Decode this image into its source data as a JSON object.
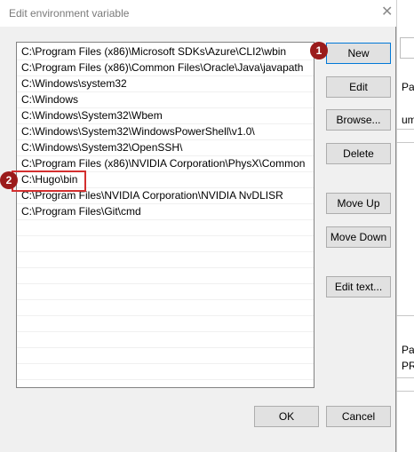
{
  "dialog": {
    "title": "Edit environment variable",
    "close_glyph": "✕"
  },
  "paths": [
    "C:\\Program Files (x86)\\Microsoft SDKs\\Azure\\CLI2\\wbin",
    "C:\\Program Files (x86)\\Common Files\\Oracle\\Java\\javapath",
    "C:\\Windows\\system32",
    "C:\\Windows",
    "C:\\Windows\\System32\\Wbem",
    "C:\\Windows\\System32\\WindowsPowerShell\\v1.0\\",
    "C:\\Windows\\System32\\OpenSSH\\",
    "C:\\Program Files (x86)\\NVIDIA Corporation\\PhysX\\Common",
    "C:\\Hugo\\bin",
    "C:\\Program Files\\NVIDIA Corporation\\NVIDIA NvDLISR",
    "C:\\Program Files\\Git\\cmd"
  ],
  "buttons": {
    "new": "New",
    "edit": "Edit",
    "browse": "Browse...",
    "delete": "Delete",
    "move_up": "Move Up",
    "move_down": "Move Down",
    "edit_text": "Edit text...",
    "ok": "OK",
    "cancel": "Cancel"
  },
  "annotations": {
    "badge1": "1",
    "badge2": "2"
  },
  "background": {
    "pat1": "Pat",
    "um": "um",
    "pat2": "Pat",
    "pro": "PRO"
  },
  "colors": {
    "badge": "#9b1b1b",
    "highlight": "#d32f2f",
    "focus_border": "#0078d7"
  }
}
